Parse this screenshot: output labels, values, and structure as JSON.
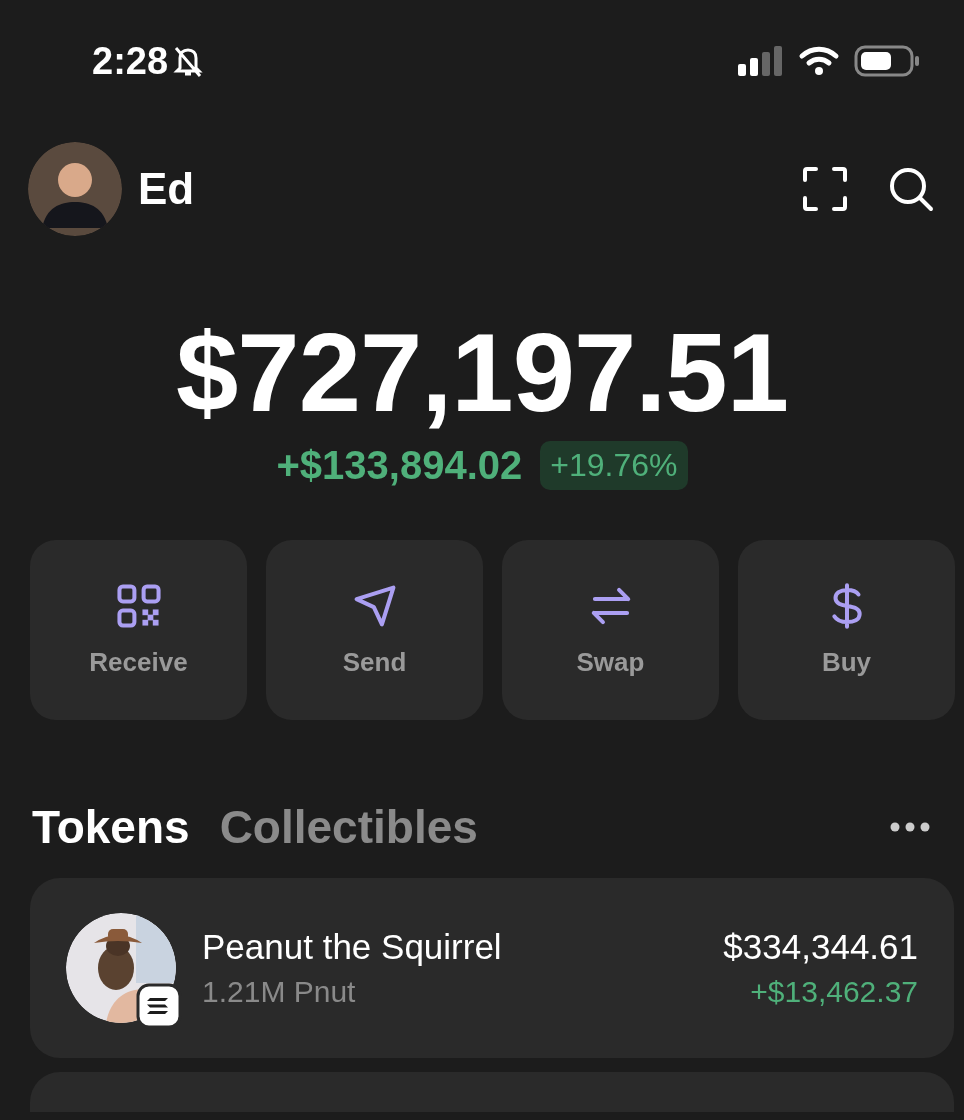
{
  "status_bar": {
    "time": "2:28",
    "silent": true
  },
  "header": {
    "account_name": "Ed"
  },
  "balance": {
    "total": "$727,197.51",
    "change": "+$133,894.02",
    "change_percent": "+19.76%"
  },
  "actions": [
    {
      "kind": "receive",
      "label": "Receive"
    },
    {
      "kind": "send",
      "label": "Send"
    },
    {
      "kind": "swap",
      "label": "Swap"
    },
    {
      "kind": "buy",
      "label": "Buy"
    }
  ],
  "tabs": [
    {
      "label": "Tokens",
      "selected": true
    },
    {
      "label": "Collectibles",
      "selected": false
    }
  ],
  "tokens": [
    {
      "name": "Peanut the Squirrel",
      "amount": "1.21M Pnut",
      "value": "$334,344.61",
      "change": "+$13,462.37"
    }
  ]
}
